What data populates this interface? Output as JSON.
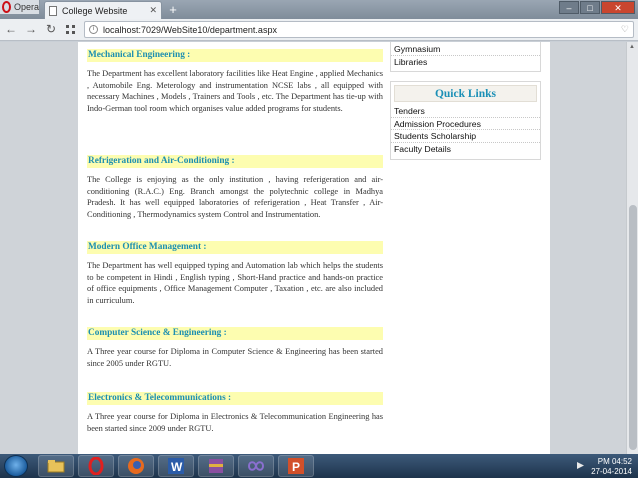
{
  "browser": {
    "menu_label": "Opera",
    "tab_title": "College Website",
    "new_tab_symbol": "+",
    "url": "localhost:7029/WebSite10/department.aspx"
  },
  "sidebar_top": [
    "Gymnasium",
    "Libraries"
  ],
  "quick_links": {
    "title": "Quick Links",
    "items": [
      "Tenders",
      "Admission Procedures",
      "Students Scholarship",
      "Faculty Details"
    ]
  },
  "sections": [
    {
      "heading": "Mechanical Engineering :",
      "body": "The Department has excellent laboratory facilities like Heat Engine , applied Mechanics , Automobile Eng. Meterology and instrumentation NCSE labs , all equipped with necessary Machines , Models , Trainers and Tools , etc. The Department has tie-up with Indo-German tool room which organises value added programs for students."
    },
    {
      "heading": "Refrigeration and Air-Conditioning :",
      "body": "The College is enjoying as the only institution , having referigeration and air-conditioning (R.A.C.) Eng. Branch amongst the polytechnic college in Madhya Pradesh. It has well equipped laboratories of referigeration , Heat Transfer , Air-Conditioning , Thermodynamics system Control and Instrumentation."
    },
    {
      "heading": "Modern Office Management :",
      "body": "The Department has well equipped typing and Automation lab which helps the students to be competent in Hindi , English typing , Short-Hand practice and hands-on practice of office equipments , Office Management Computer , Taxation , etc. are also included in curriculum."
    },
    {
      "heading": "Computer Science & Engineering :",
      "body": "A Three year course for Diploma in Computer Science & Engineering has been started since 2005 under RGTU."
    },
    {
      "heading": "Electronics & Telecommunications :",
      "body": "A Three year course for Diploma in Electronics  & Telecommunication Engineering has been started since 2009 under RGTU."
    }
  ],
  "taskbar": {
    "time": "PM 04:52",
    "date": "27-04-2014",
    "apps": [
      "explorer",
      "opera",
      "firefox",
      "word",
      "winrar",
      "visual-studio",
      "powerpoint"
    ]
  }
}
